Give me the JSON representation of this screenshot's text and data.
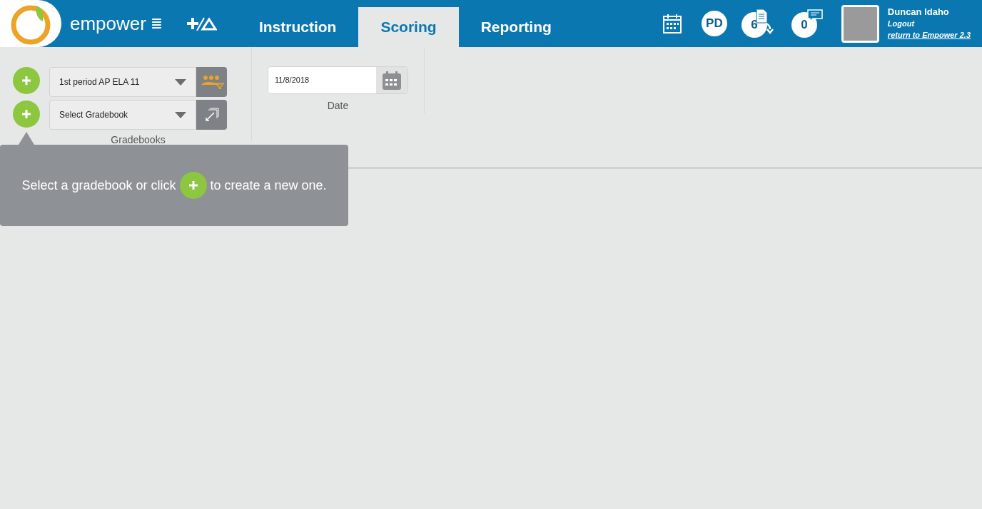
{
  "header": {
    "brand": "empower",
    "menu_glyph": "≣",
    "tabs": [
      {
        "label": "Instruction",
        "selected": false
      },
      {
        "label": "Scoring",
        "selected": true
      },
      {
        "label": "Reporting",
        "selected": false
      }
    ],
    "badges": [
      {
        "kind": "initials",
        "text": "PD"
      },
      {
        "kind": "downloads",
        "text": "6"
      },
      {
        "kind": "messages",
        "text": "0"
      }
    ],
    "user": {
      "name": "Duncan Idaho",
      "logout": "Logout",
      "return_link": "return to Empower 2.3"
    }
  },
  "filters": {
    "class_select": {
      "value": "1st period AP ELA 11"
    },
    "gradebook_select": {
      "value": "Select Gradebook"
    },
    "gradebooks_label": "Gradebooks",
    "date": {
      "value": "11/8/2018",
      "label": "Date"
    }
  },
  "tooltip": {
    "before": "Select a gradebook or click",
    "after": "to create a new one."
  }
}
